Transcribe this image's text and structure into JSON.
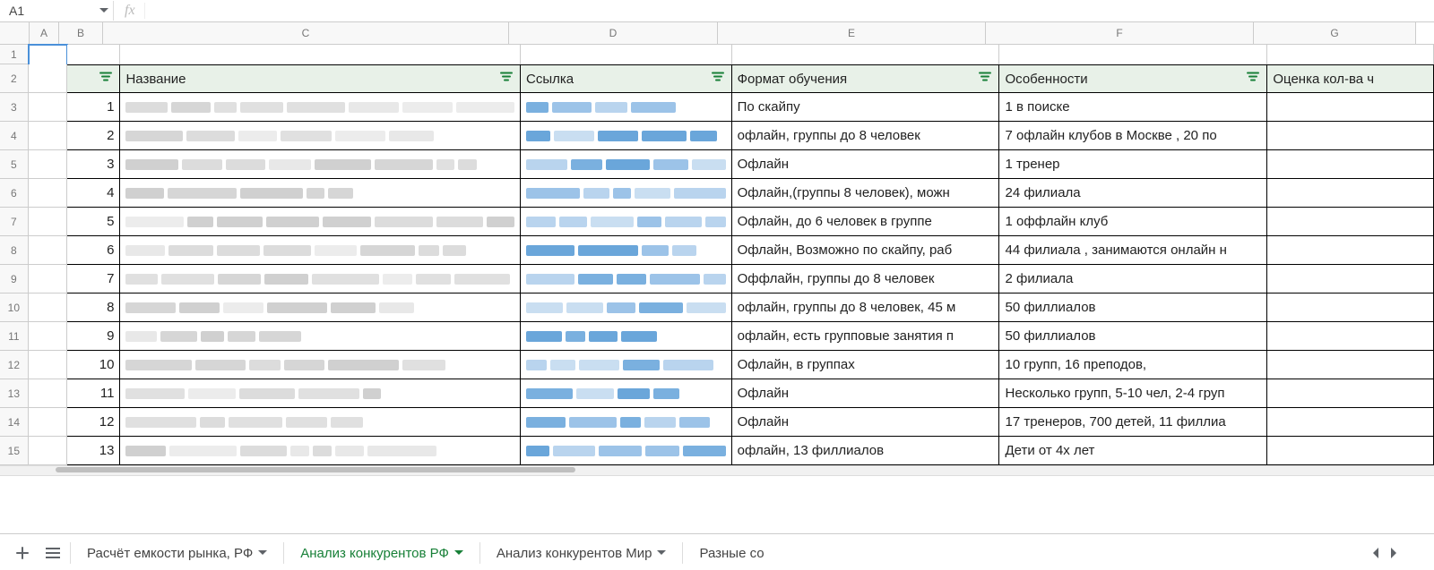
{
  "nameBox": "A1",
  "fxValue": "",
  "columns": [
    "A",
    "B",
    "C",
    "D",
    "E",
    "F",
    "G"
  ],
  "rowNumbers": [
    "1",
    "2",
    "3",
    "4",
    "5",
    "6",
    "7",
    "8",
    "9",
    "10",
    "11",
    "12",
    "13",
    "14",
    "15"
  ],
  "headers": {
    "b": "",
    "c": "Название",
    "d": "Ссылка",
    "e": "Формат обучения",
    "f": "Особенности",
    "g": "Оценка кол-ва ч"
  },
  "rows": [
    {
      "n": "1",
      "e": "По скайпу",
      "f": "1 в поиске"
    },
    {
      "n": "2",
      "e": "офлайн, группы до 8 человек",
      "f": "7 офлайн клубов в Москве , 20 по"
    },
    {
      "n": "3",
      "e": "Офлайн",
      "f": "1 тренер"
    },
    {
      "n": "4",
      "e": "Офлайн,(группы 8 человек), можн",
      "f": "24 филиала"
    },
    {
      "n": "5",
      "e": "Офлайн, до 6 человек в группе",
      "f": "1 оффлайн клуб"
    },
    {
      "n": "6",
      "e": "Офлайн, Возможно по скайпу, раб",
      "f": "44 филиала , занимаются онлайн н"
    },
    {
      "n": "7",
      "e": "Оффлайн, группы до 8 человек",
      "f": "2 филиала"
    },
    {
      "n": "8",
      "e": "офлайн, группы до 8 человек, 45 м",
      "f": "50 филлиалов"
    },
    {
      "n": "9",
      "e": "офлайн, есть групповые занятия п",
      "f": "50 филлиалов"
    },
    {
      "n": "10",
      "e": "Офлайн, в группах",
      "f": "10 групп, 16 преподов,"
    },
    {
      "n": "11",
      "e": "Офлайн",
      "f": "Несколько групп, 5-10 чел, 2-4 груп"
    },
    {
      "n": "12",
      "e": "Офлайн",
      "f": "17 тренеров, 700 детей, 11 филлиа"
    },
    {
      "n": "13",
      "e": "офлайн, 13 филлиалов",
      "f": "Дети от 4х лет"
    }
  ],
  "tabs": [
    {
      "label": "Расчёт емкости рынка, РФ",
      "active": false
    },
    {
      "label": "Анализ конкурентов РФ",
      "active": true
    },
    {
      "label": "Анализ конкурентов Мир",
      "active": false
    },
    {
      "label": "Разные со",
      "active": false
    }
  ]
}
